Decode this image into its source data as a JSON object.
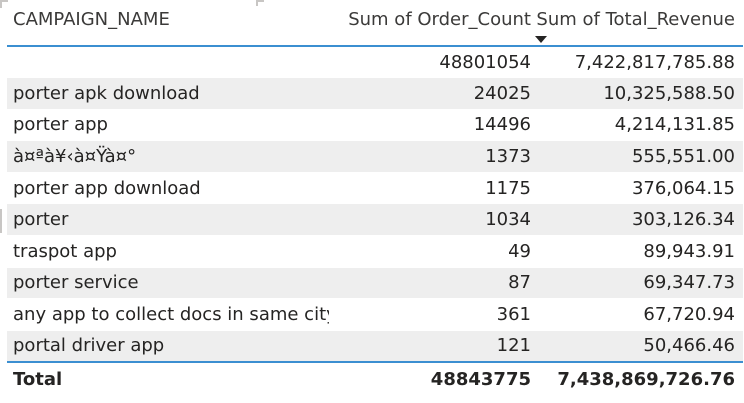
{
  "table": {
    "headers": {
      "campaign_name": "CAMPAIGN_NAME",
      "order_count": "Sum of Order_Count",
      "total_revenue": "Sum of Total_Revenue"
    },
    "sorted_column": "total_revenue",
    "sort_direction": "descending",
    "rows": [
      {
        "name": "",
        "order_count": "48801054",
        "revenue": "7,422,817,785.88"
      },
      {
        "name": "porter apk download",
        "order_count": "24025",
        "revenue": "10,325,588.50"
      },
      {
        "name": "porter app",
        "order_count": "14496",
        "revenue": "4,214,131.85"
      },
      {
        "name": "à¤ªà¥‹à¤Ÿà¤°",
        "order_count": "1373",
        "revenue": "555,551.00"
      },
      {
        "name": "porter app download",
        "order_count": "1175",
        "revenue": "376,064.15"
      },
      {
        "name": "porter",
        "order_count": "1034",
        "revenue": "303,126.34"
      },
      {
        "name": "traspot app",
        "order_count": "49",
        "revenue": "89,943.91"
      },
      {
        "name": "porter service",
        "order_count": "87",
        "revenue": "69,347.73"
      },
      {
        "name": "any app to collect docs in same city",
        "order_count": "361",
        "revenue": "67,720.94"
      },
      {
        "name": "portal driver app",
        "order_count": "121",
        "revenue": "50,466.46"
      }
    ],
    "total": {
      "label": "Total",
      "order_count": "48843775",
      "revenue": "7,438,869,726.76"
    }
  },
  "colors": {
    "header_rule": "#3b8fd1",
    "alt_row": "#eeeeee",
    "text": "#252423"
  }
}
